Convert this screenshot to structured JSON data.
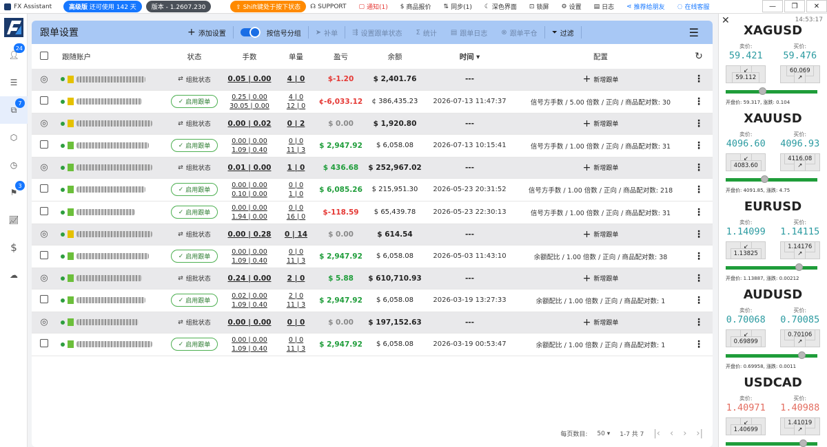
{
  "topbar": {
    "app_title": "FX Assistant",
    "edition": "高级版",
    "days": "还可使用 142 天",
    "version": "版本 - 1.2607.230",
    "shift_notice": "Shift键处于按下状态",
    "support": "SUPPORT",
    "notice": "通知(1)",
    "quote": "商品报价",
    "sync": "同步(1)",
    "dark": "深色界面",
    "lock": "锁屏",
    "settings": "设置",
    "log": "日志",
    "recommend": "推荐给朋友",
    "online": "在线客服"
  },
  "sidebar": {
    "badges": {
      "users": "24",
      "copy": "7",
      "flag": "3"
    }
  },
  "toolbar": {
    "title": "跟单设置",
    "add": "添加设置",
    "group_by_signal": "按信号分组",
    "fill": "补单",
    "set_status": "设置跟单状态",
    "stats": "统计",
    "log": "跟单日志",
    "close": "跟单平仓",
    "filter": "过滤"
  },
  "table": {
    "headers": {
      "account": "跟随账户",
      "status": "状态",
      "lots": "手数",
      "count": "单量",
      "pnl": "盈亏",
      "balance": "余额",
      "time": "时间",
      "config": "配置"
    },
    "batch_status": "组批状态",
    "enable_label": "启用跟单",
    "add_follow": "新增跟单",
    "empty_time": "---",
    "rows": [
      {
        "kind": "grp",
        "lots": "0.05 | 0.00",
        "count": "4 | 0",
        "pnl": "$-1.20",
        "pnlc": "red",
        "bal": "$ 2,401.76",
        "sq": "#e5c100",
        "w": 100
      },
      {
        "kind": "sub",
        "lots1": "0.25 | 0.00",
        "lots2": "30.05 | 0.00",
        "cnt1": "4 | 0",
        "cnt2": "12 | 0",
        "pnl": "¢-6,033.12",
        "pnlc": "red",
        "bal": "¢ 386,435.23",
        "time": "2026-07-13 11:47:37",
        "cfg": "信号方手数 / 5.00 倍数 / 正向 / 商品配对数: 30",
        "sq": "#e5c100",
        "w": 95
      },
      {
        "kind": "grp",
        "lots": "0.00 | 0.02",
        "count": "0 | 2",
        "pnl": "$ 0.00",
        "pnlc": "gray",
        "bal": "$ 1,920.80",
        "sq": "#e5c100",
        "w": 110
      },
      {
        "kind": "sub",
        "lots1": "0.00 | 0.00",
        "lots2": "1.09 | 0.40",
        "cnt1": "0 | 0",
        "cnt2": "11 | 3",
        "pnl": "$ 2,947.92",
        "pnlc": "green",
        "bal": "$ 6,058.08",
        "time": "2026-07-13 10:15:41",
        "cfg": "信号方手数 / 1.00 倍数 / 正向 / 商品配对数: 31",
        "sq": "#6cbf3b",
        "w": 105
      },
      {
        "kind": "grp",
        "lots": "0.01 | 0.00",
        "count": "1 | 0",
        "pnl": "$ 436.68",
        "pnlc": "green",
        "bal": "$ 252,967.02",
        "sq": "#6cbf3b",
        "w": 110
      },
      {
        "kind": "sub",
        "lots1": "0.00 | 0.00",
        "lots2": "0.10 | 0.00",
        "cnt1": "0 | 0",
        "cnt2": "1 | 0",
        "pnl": "$ 6,085.26",
        "pnlc": "green",
        "bal": "$ 215,951.30",
        "time": "2026-05-23 20:31:52",
        "cfg": "信号方手数 / 1.00 倍数 / 正向 / 商品配对数: 218",
        "sq": "#6cbf3b",
        "w": 100
      },
      {
        "kind": "sub",
        "lots1": "0.00 | 0.00",
        "lots2": "1.94 | 0.00",
        "cnt1": "0 | 0",
        "cnt2": "16 | 0",
        "pnl": "$-118.59",
        "pnlc": "red",
        "bal": "$ 65,439.78",
        "time": "2026-05-23 22:30:13",
        "cfg": "信号方手数 / 1.00 倍数 / 正向 / 商品配对数: 31",
        "sq": "#6cbf3b",
        "w": 85
      },
      {
        "kind": "grp",
        "lots": "0.00 | 0.28",
        "count": "0 | 14",
        "pnl": "$ 0.00",
        "pnlc": "gray",
        "bal": "$ 614.54",
        "sq": "#e5c100",
        "w": 110
      },
      {
        "kind": "sub",
        "lots1": "0.00 | 0.00",
        "lots2": "1.09 | 0.40",
        "cnt1": "0 | 0",
        "cnt2": "11 | 3",
        "pnl": "$ 2,947.92",
        "pnlc": "green",
        "bal": "$ 6,058.08",
        "time": "2026-05-03 11:43:10",
        "cfg": "余额配比 / 1.00 倍数 / 正向 / 商品配对数: 38",
        "sq": "#6cbf3b",
        "w": 105
      },
      {
        "kind": "grp",
        "lots": "0.24 | 0.00",
        "count": "2 | 0",
        "pnl": "$ 5.88",
        "pnlc": "green",
        "bal": "$ 610,710.93",
        "sq": "#6cbf3b",
        "w": 95
      },
      {
        "kind": "sub",
        "lots1": "0.02 | 0.00",
        "lots2": "1.09 | 0.40",
        "cnt1": "2 | 0",
        "cnt2": "11 | 3",
        "pnl": "$ 2,947.92",
        "pnlc": "green",
        "bal": "$ 6,058.08",
        "time": "2026-03-19 13:27:33",
        "cfg": "余额配比 / 1.00 倍数 / 正向 / 商品配对数: 1",
        "sq": "#6cbf3b",
        "w": 100
      },
      {
        "kind": "grp",
        "lots": "0.00 | 0.00",
        "count": "0 | 0",
        "pnl": "$ 0.00",
        "pnlc": "gray",
        "bal": "$ 197,152.63",
        "sq": "#6cbf3b",
        "w": 90
      },
      {
        "kind": "sub",
        "lots1": "0.00 | 0.00",
        "lots2": "1.09 | 0.40",
        "cnt1": "0 | 0",
        "cnt2": "11 | 3",
        "pnl": "$ 2,947.92",
        "pnlc": "green",
        "bal": "$ 6,058.08",
        "time": "2026-03-19 00:53:47",
        "cfg": "余额配比 / 1.00 倍数 / 正向 / 商品配对数: 1",
        "sq": "#6cbf3b",
        "w": 110
      }
    ]
  },
  "pager": {
    "per_page_label": "每页数目:",
    "per_page": "50",
    "range": "1-7 共 7"
  },
  "quotes": {
    "time": "14:53:17",
    "bid_label": "卖价:",
    "ask_label": "买价:",
    "items": [
      {
        "symbol": "XAGUSD",
        "bid": "59.421",
        "ask": "59.476",
        "low": "59.112",
        "high": "60.069",
        "open": "开盘价: 59.317, 涨跌: 0.104",
        "level": 0.4
      },
      {
        "symbol": "XAUUSD",
        "bid": "4096.60",
        "ask": "4096.93",
        "low": "4083.60",
        "high": "4116.08",
        "open": "开盘价: 4091.85, 涨跌: 4.75",
        "level": 0.42
      },
      {
        "symbol": "EURUSD",
        "bid": "1.14099",
        "ask": "1.14115",
        "low": "1.13825",
        "high": "1.14176",
        "open": "开盘价: 1.13887, 涨跌: 0.00212",
        "level": 0.8
      },
      {
        "symbol": "AUDUSD",
        "bid": "0.70068",
        "ask": "0.70085",
        "low": "0.69899",
        "high": "0.70106",
        "open": "开盘价: 0.69958, 涨跌: 0.0011",
        "level": 0.83
      },
      {
        "symbol": "USDCAD",
        "bid": "1.40971",
        "ask": "1.40988",
        "low": "1.40699",
        "high": "1.41019",
        "open": "",
        "level": 0.84
      }
    ]
  }
}
